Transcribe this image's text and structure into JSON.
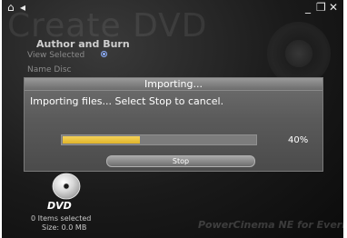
{
  "background_title": "Create DVD",
  "window_controls": {
    "home_icon": "home-icon",
    "back_icon": "back-arrow-icon",
    "minimize_icon": "minimize-icon",
    "restore_icon": "restore-icon",
    "close_icon": "close-icon"
  },
  "nav": {
    "title": "Author and Burn",
    "view_selected": "View Selected",
    "name_disc": "Name Disc"
  },
  "dialog": {
    "title": "Importing...",
    "message": "Importing files... Select Stop to cancel.",
    "progress_percent_label": "40%",
    "progress_fraction": 0.4,
    "stop_label": "Stop"
  },
  "footer": {
    "dvd_label": "DVD",
    "items_selected": "0 Items selected",
    "size": "Size: 0.0 MB"
  },
  "brand": "PowerCinema NE for Everio",
  "colors": {
    "progress_fill": "#e0b42a",
    "background": "#1a1a1a",
    "dialog": "#5a5a5a"
  }
}
